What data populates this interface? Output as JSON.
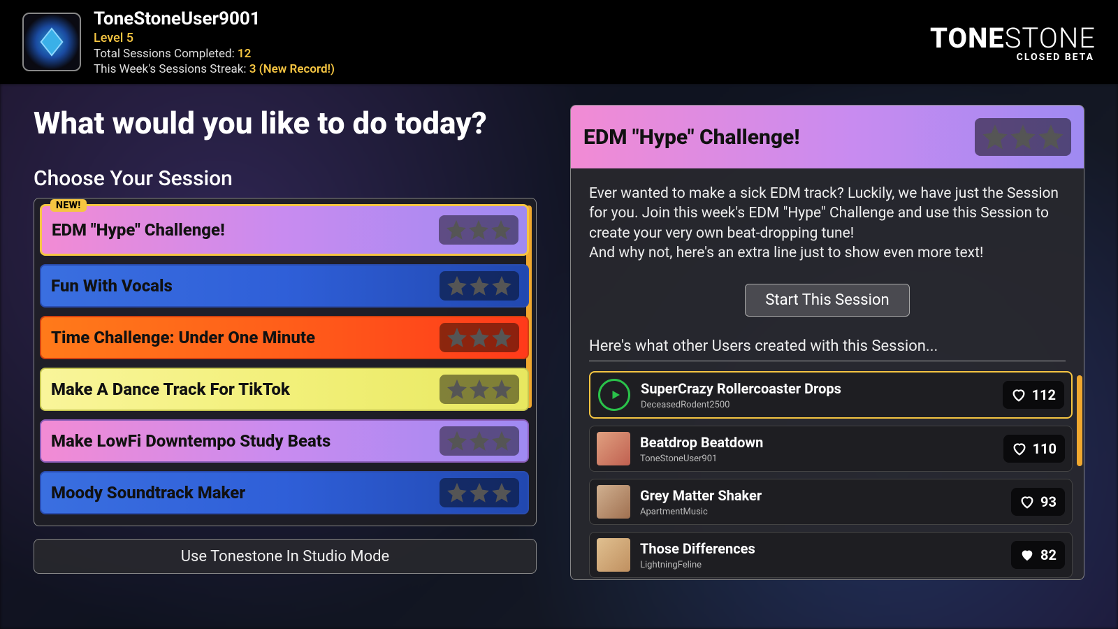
{
  "header": {
    "username": "ToneStoneUser9001",
    "level": "Level 5",
    "sessions_label": "Total Sessions Completed:",
    "sessions_value": "12",
    "streak_label": "This Week's Sessions Streak:",
    "streak_value": "3 (New Record!)",
    "logo_main": "TONESTONE",
    "logo_sub": "CLOSED BETA"
  },
  "main": {
    "heading": "What would you like to do today?",
    "choose_label": "Choose Your Session",
    "studio_button": "Use Tonestone In Studio Mode"
  },
  "sessions": [
    {
      "title": "EDM \"Hype\" Challenge!",
      "badge": "NEW!",
      "gradient": "grad-pink",
      "selected": true
    },
    {
      "title": "Fun With Vocals",
      "gradient": "grad-blue"
    },
    {
      "title": "Time Challenge: Under One Minute",
      "gradient": "grad-orange"
    },
    {
      "title": "Make A Dance Track For TikTok",
      "gradient": "grad-yellow"
    },
    {
      "title": "Make LowFi Downtempo Study Beats",
      "gradient": "grad-pink"
    },
    {
      "title": "Moody Soundtrack Maker",
      "gradient": "grad-blue2"
    }
  ],
  "challenge": {
    "title": "EDM \"Hype\" Challenge!",
    "description_l1": "Ever wanted to make a sick EDM track? Luckily, we have just the Session for you. Join this week's EDM \"Hype\" Challenge and use this Session to create your very own beat-dropping tune!",
    "description_l2": "And why not, here's an extra line just to show even more text!",
    "start_button": "Start This Session",
    "others_label": "Here's what other Users created with this Session..."
  },
  "tracks": [
    {
      "name": "SuperCrazy Rollercoaster Drops",
      "author": "DeceasedRodent2500",
      "likes": "112",
      "selected": true,
      "playing": true,
      "liked": false
    },
    {
      "name": "Beatdrop Beatdown",
      "author": "ToneStoneUser901",
      "likes": "110",
      "liked": false,
      "avatar_bg": "linear-gradient(135deg,#e0a080,#c06050)"
    },
    {
      "name": "Grey Matter Shaker",
      "author": "ApartmentMusic",
      "likes": "93",
      "liked": false,
      "avatar_bg": "linear-gradient(135deg,#d0b090,#a07050)"
    },
    {
      "name": "Those Differences",
      "author": "LightningFeline",
      "likes": "82",
      "liked": true,
      "avatar_bg": "linear-gradient(135deg,#e0c090,#c09060)"
    }
  ]
}
